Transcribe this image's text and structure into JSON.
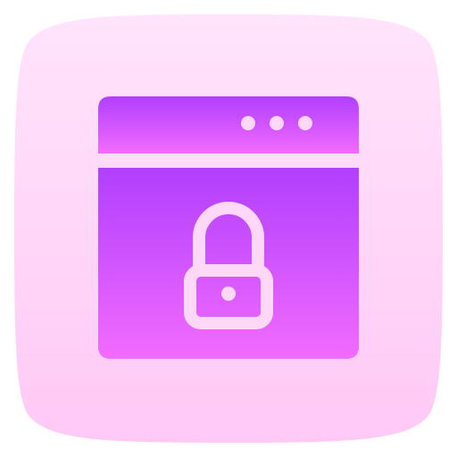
{
  "icon": {
    "name": "secure-browser-lock-icon",
    "colors": {
      "squircle_top": "#ffe4fb",
      "squircle_bottom": "#ffc9f6",
      "window_top": "#b13ffe",
      "window_bottom": "#f26bff",
      "glyph": "#ffd8f8"
    }
  }
}
